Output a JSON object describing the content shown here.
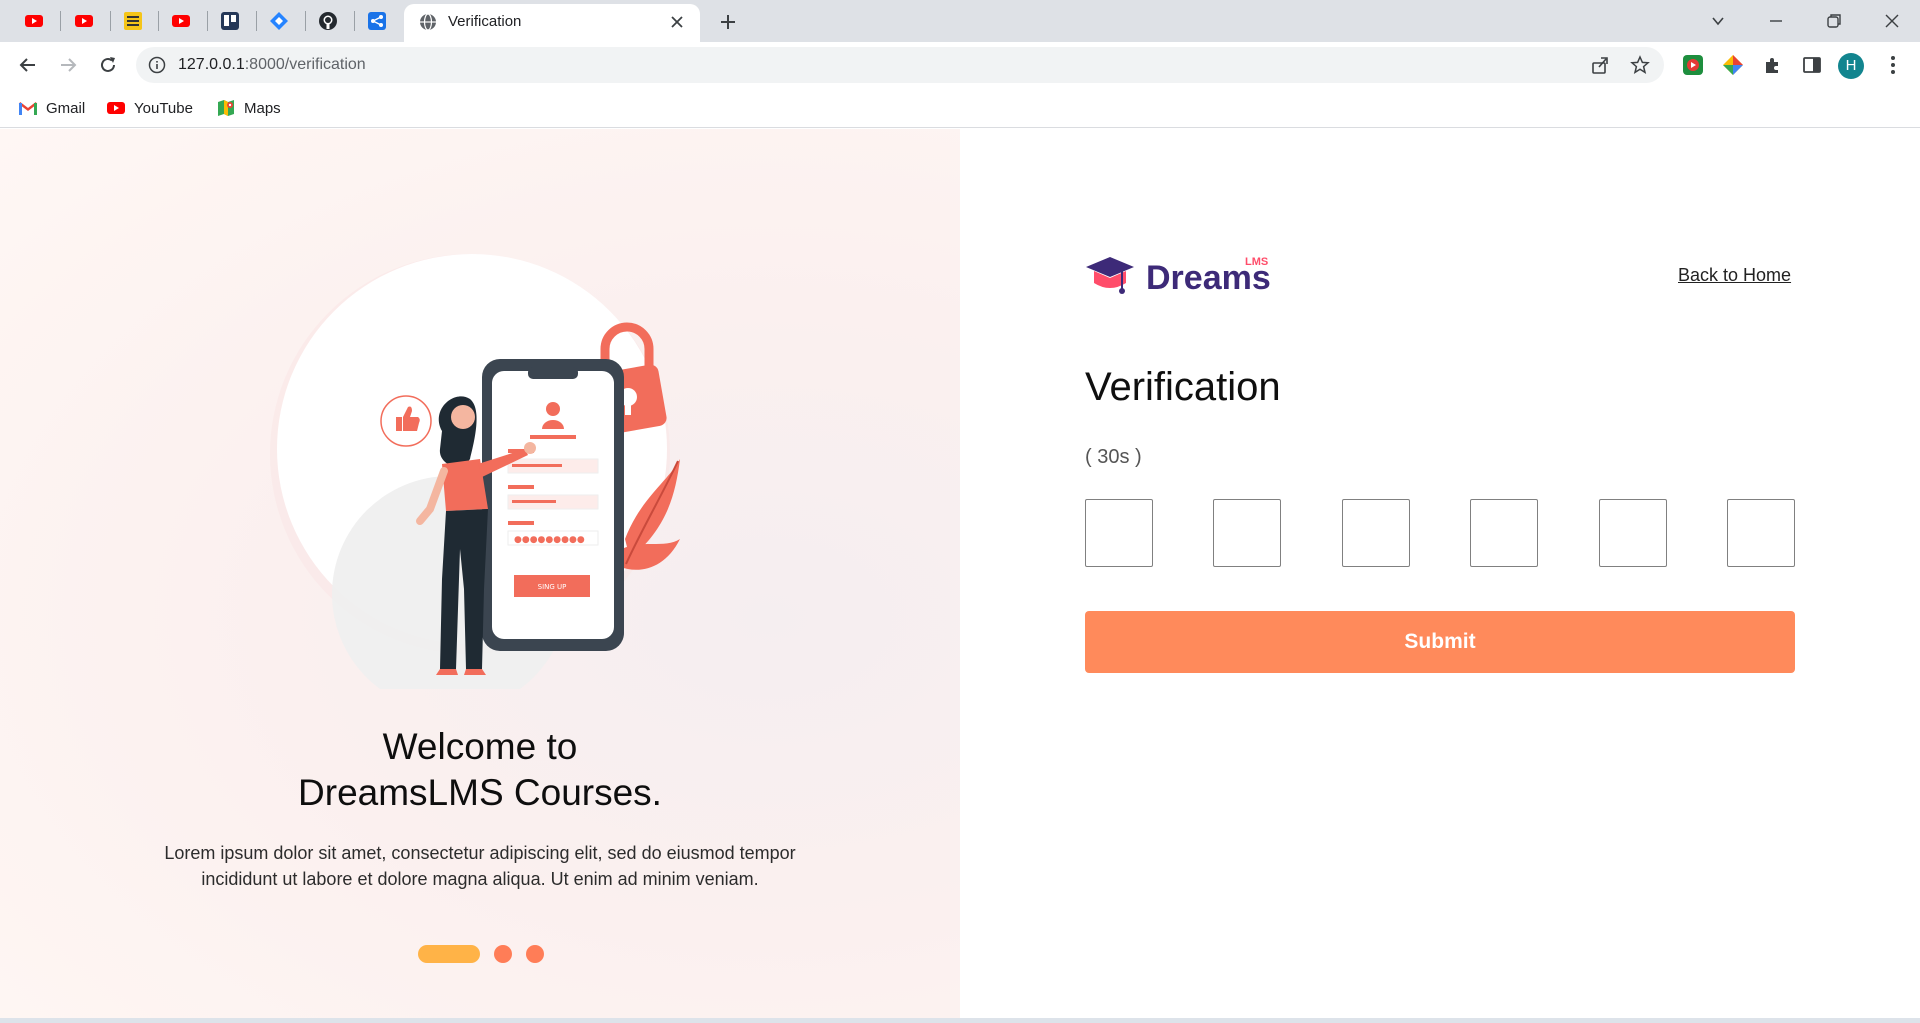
{
  "browser": {
    "pinned_tabs": [
      {
        "icon": "youtube-icon"
      },
      {
        "icon": "youtube-icon"
      },
      {
        "icon": "menu-icon-yellow"
      },
      {
        "icon": "youtube-icon"
      },
      {
        "icon": "trello-icon"
      },
      {
        "icon": "jira-icon"
      },
      {
        "icon": "github-icon"
      },
      {
        "icon": "share-icon"
      }
    ],
    "active_tab": {
      "title": "Verification"
    },
    "url": {
      "host": "127.0.0.1",
      "path": ":8000/verification"
    },
    "profile_initial": "H",
    "bookmarks": [
      {
        "label": "Gmail",
        "icon": "gmail-icon"
      },
      {
        "label": "YouTube",
        "icon": "youtube-icon"
      },
      {
        "label": "Maps",
        "icon": "maps-icon"
      }
    ]
  },
  "left": {
    "illustration": {
      "signup_label": "SING UP"
    },
    "welcome_line1": "Welcome to",
    "welcome_line2": "DreamsLMS Courses.",
    "lorem_line1": "Lorem ipsum dolor sit amet, consectetur adipiscing elit, sed do eiusmod tempor",
    "lorem_line2": "incididunt ut labore et dolore magna aliqua. Ut enim ad minim veniam.",
    "carousel": {
      "count": 3,
      "active_index": 0
    }
  },
  "right": {
    "logo": {
      "text": "Dreams",
      "superscript": "LMS"
    },
    "back_home": "Back to Home",
    "title": "Verification",
    "timer": "( 30s )",
    "otp_values": [
      "",
      "",
      "",
      "",
      "",
      ""
    ],
    "submit_label": "Submit"
  },
  "colors": {
    "accent": "#ff8a5b",
    "carousel_active": "#ffb347",
    "carousel_dot": "#ff7d57",
    "logo_purple": "#3d2a78",
    "logo_pink": "#ff4d6a"
  }
}
